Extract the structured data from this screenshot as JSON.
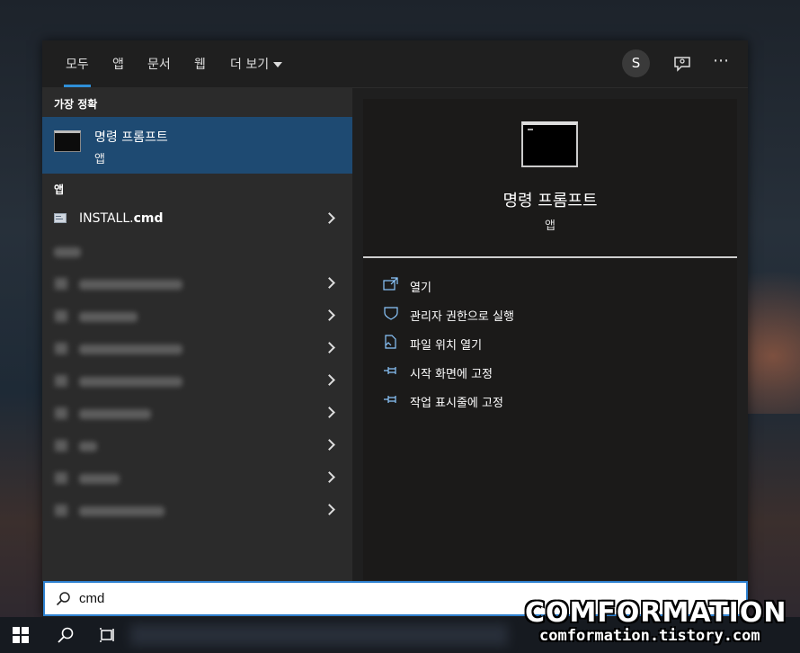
{
  "header": {
    "tabs": [
      {
        "label": "모두"
      },
      {
        "label": "앱"
      },
      {
        "label": "문서"
      },
      {
        "label": "웹"
      },
      {
        "label": "더 보기"
      }
    ],
    "avatar_initial": "S",
    "more_icon": "⋯"
  },
  "left": {
    "best_match_heading": "가장 정확",
    "best_match": {
      "title": "명령 프롬프트",
      "subtitle": "앱"
    },
    "apps_heading": "앱",
    "apps": [
      {
        "label": "INSTALL.cmd"
      }
    ]
  },
  "detail": {
    "title": "명령 프롬프트",
    "subtitle": "앱",
    "actions": [
      {
        "label": "열기",
        "icon": "open-icon"
      },
      {
        "label": "관리자 권한으로 실행",
        "icon": "shield-icon"
      },
      {
        "label": "파일 위치 열기",
        "icon": "file-location-icon"
      },
      {
        "label": "시작 화면에 고정",
        "icon": "pin-icon"
      },
      {
        "label": "작업 표시줄에 고정",
        "icon": "pin-icon"
      }
    ]
  },
  "search": {
    "value": "cmd"
  },
  "watermark": {
    "brand": "COMFORMATION",
    "site": "comformation.tistory.com"
  },
  "colors": {
    "accent": "#2f8fd8",
    "selection": "#1e4a72"
  }
}
